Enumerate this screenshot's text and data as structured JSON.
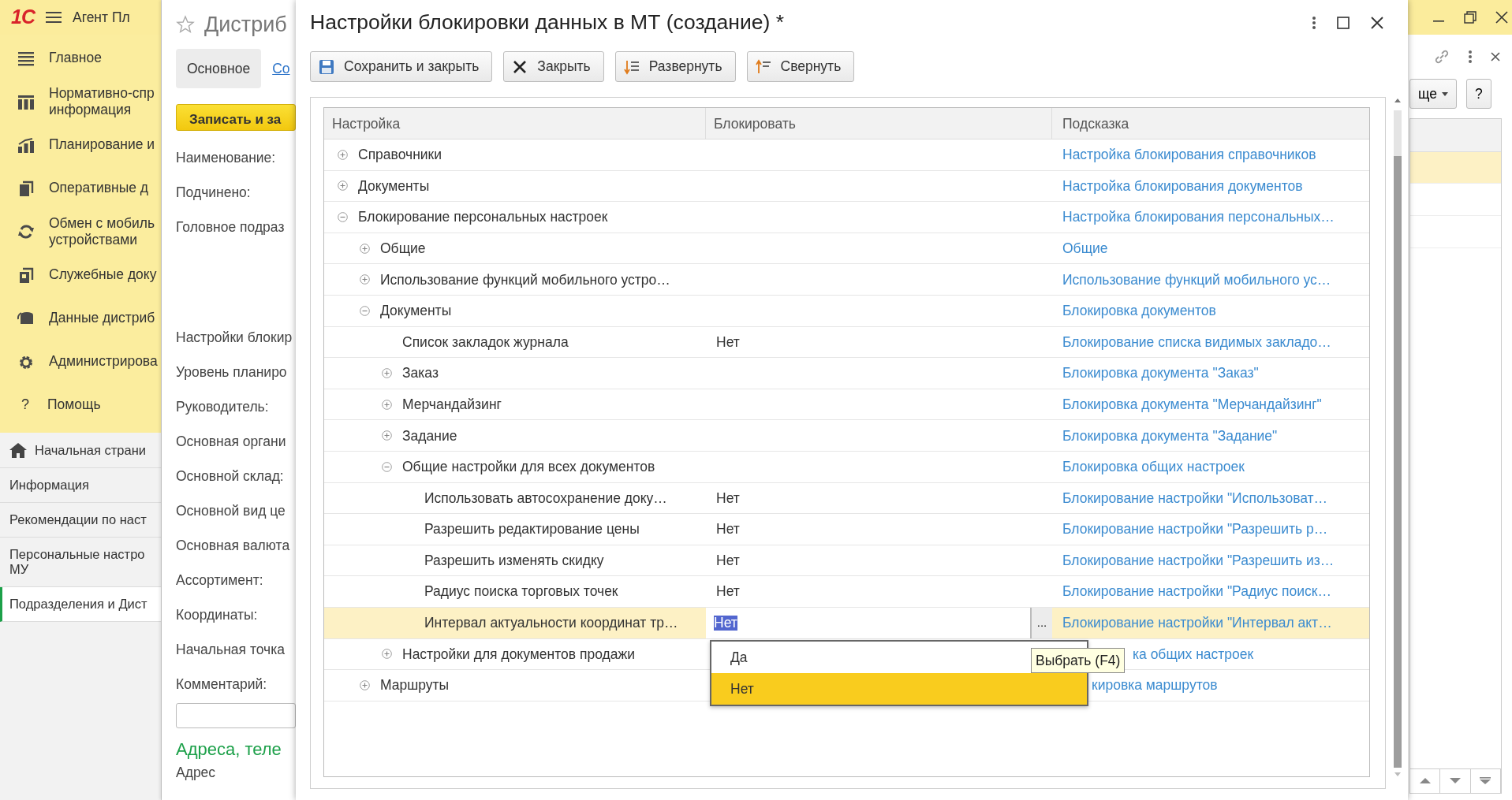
{
  "app": {
    "logo": "1С",
    "title": "Агент Пл"
  },
  "sections": [
    {
      "label": "Главное"
    },
    {
      "label": "Нормативно-спр\nинформация"
    },
    {
      "label": "Планирование и"
    },
    {
      "label": "Оперативные д"
    },
    {
      "label": "Обмен с мобиль\nустройствами"
    },
    {
      "label": "Служебные доку"
    },
    {
      "label": "Данные дистриб"
    },
    {
      "label": "Администрирова"
    },
    {
      "label": "Помощь",
      "glyph": "?"
    }
  ],
  "nav": [
    {
      "label": "Начальная страни",
      "selected": false
    },
    {
      "label": "Информация",
      "selected": false
    },
    {
      "label": "Рекомендации по наст",
      "selected": false
    },
    {
      "label": "Персональные настро\nМУ",
      "selected": false
    },
    {
      "label": "Подразделения и Дист",
      "selected": true
    }
  ],
  "form": {
    "title": "Дистриб",
    "tab": "Основное",
    "link": "Со",
    "save_button": "Записать и за",
    "labels": [
      "Наименование:",
      "Подчинено:",
      "Головное подраз",
      "Настройки блокир",
      "Уровень планиро",
      "Руководитель:",
      "Основная органи",
      "Основной склад:",
      "Основной вид це",
      "Основная валюта",
      "Ассортимент:",
      "Координаты:",
      "Начальная точка",
      "Комментарий:"
    ],
    "section_title": "Адреса, теле",
    "last_label": "Адрес"
  },
  "right_panel": {
    "more_button": "ще",
    "help_button": "?"
  },
  "dialog": {
    "title": "Настройки блокировки данных в МТ (создание) *",
    "toolbar": [
      {
        "label": "Сохранить и закрыть"
      },
      {
        "label": "Закрыть"
      },
      {
        "label": "Развернуть"
      },
      {
        "label": "Свернуть"
      }
    ],
    "columns": [
      "Настройка",
      "Блокировать",
      "Подсказка"
    ],
    "rows": [
      {
        "kind": "group",
        "label": "Справочники",
        "expanded": false,
        "selected": false,
        "hint": "Настройка блокирования справочников"
      },
      {
        "kind": "group",
        "label": "Документы",
        "expanded": false,
        "selected": false,
        "hint": "Настройка блокирования документов"
      },
      {
        "kind": "group",
        "label": "Блокирование персональных настроек",
        "expanded": true,
        "selected": false,
        "hint": "Настройка блокирования персональных…",
        "children": [
          {
            "kind": "group",
            "label": "Общие",
            "expanded": false,
            "selected": false,
            "hint": "Общие"
          },
          {
            "kind": "group",
            "label": "Использование функций мобильного устро…",
            "expanded": false,
            "selected": false,
            "hint": "Использование функций мобильного ус…"
          },
          {
            "kind": "group",
            "label": "Документы",
            "expanded": true,
            "selected": false,
            "hint": "Блокировка документов",
            "children": [
              {
                "kind": "leaf",
                "label": "Список закладок журнала",
                "value": "Нет",
                "selected": false,
                "hint": "Блокирование списка видимых закладо…"
              },
              {
                "kind": "group",
                "label": "Заказ",
                "expanded": false,
                "selected": false,
                "hint": "Блокировка документа \"Заказ\""
              },
              {
                "kind": "group",
                "label": "Мерчандайзинг",
                "expanded": false,
                "selected": false,
                "hint": "Блокировка документа \"Мерчандайзинг\""
              },
              {
                "kind": "group",
                "label": "Задание",
                "expanded": false,
                "selected": false,
                "hint": "Блокировка документа \"Задание\""
              },
              {
                "kind": "group",
                "label": "Общие настройки для всех документов",
                "expanded": true,
                "selected": false,
                "hint": "Блокировка общих настроек",
                "children": [
                  {
                    "kind": "leaf",
                    "label": "Использовать автосохранение доку…",
                    "value": "Нет",
                    "selected": false,
                    "hint": "Блокирование настройки \"Использоват…"
                  },
                  {
                    "kind": "leaf",
                    "label": "Разрешить редактирование цены",
                    "value": "Нет",
                    "selected": false,
                    "hint": "Блокирование настройки \"Разрешить р…"
                  },
                  {
                    "kind": "leaf",
                    "label": "Разрешить изменять скидку",
                    "value": "Нет",
                    "selected": false,
                    "hint": "Блокирование настройки \"Разрешить из…"
                  },
                  {
                    "kind": "leaf",
                    "label": "Радиус поиска торговых точек",
                    "value": "Нет",
                    "selected": false,
                    "hint": "Блокирование настройки \"Радиус поиск…"
                  },
                  {
                    "kind": "leaf",
                    "label": "Интервал актуальности координат тр…",
                    "value": "Нет",
                    "selected": true,
                    "hint": "Блокирование настройки \"Интервал акт…"
                  }
                ]
              },
              {
                "kind": "group",
                "label": "Настройки для документов продажи",
                "expanded": false,
                "selected": false,
                "hint": "ка общих настроек"
              }
            ]
          },
          {
            "kind": "group",
            "label": "Маршруты",
            "expanded": false,
            "selected": false,
            "hint": "кировка маршрутов"
          }
        ]
      }
    ],
    "editor_button": "...",
    "dropdown": [
      {
        "label": "Да",
        "selected": false
      },
      {
        "label": "Нет",
        "selected": true
      }
    ],
    "tooltip": "Выбрать (F4)"
  }
}
